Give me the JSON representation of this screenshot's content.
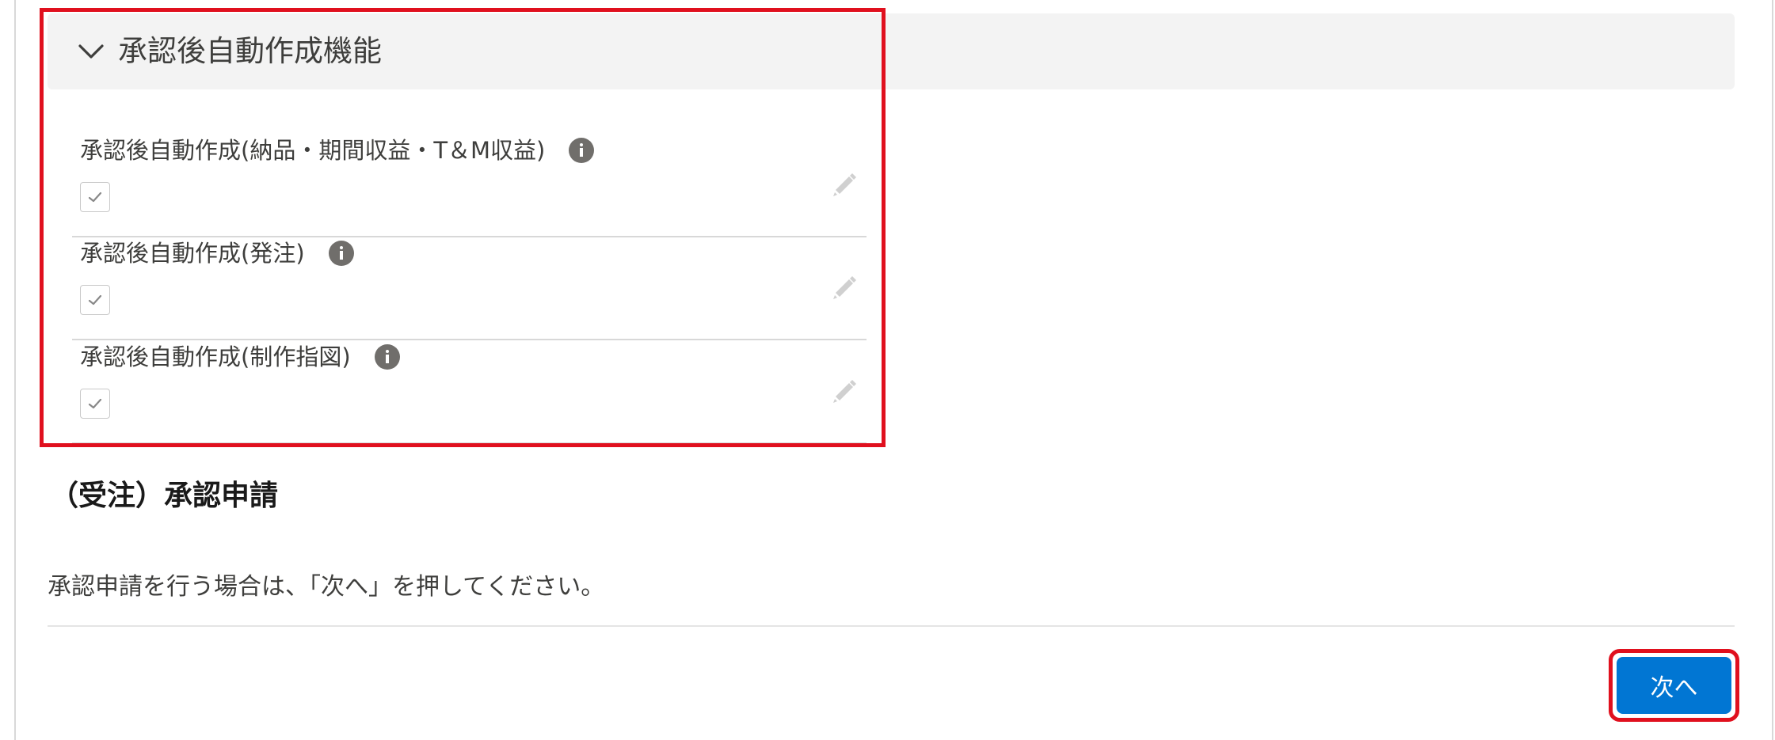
{
  "section": {
    "title": "承認後自動作成機能",
    "fields": [
      {
        "label": "承認後自動作成(納品・期間収益・T＆M収益)",
        "checked": true
      },
      {
        "label": "承認後自動作成(発注)",
        "checked": true
      },
      {
        "label": "承認後自動作成(制作指図)",
        "checked": true
      }
    ]
  },
  "approval": {
    "title": "（受注）承認申請",
    "description": "承認申請を行う場合は、「次へ」を押してください。"
  },
  "footer": {
    "next_label": "次へ"
  },
  "colors": {
    "brand_button": "#0176d3",
    "highlight": "#e0101e",
    "header_bg": "#f3f3f3"
  }
}
